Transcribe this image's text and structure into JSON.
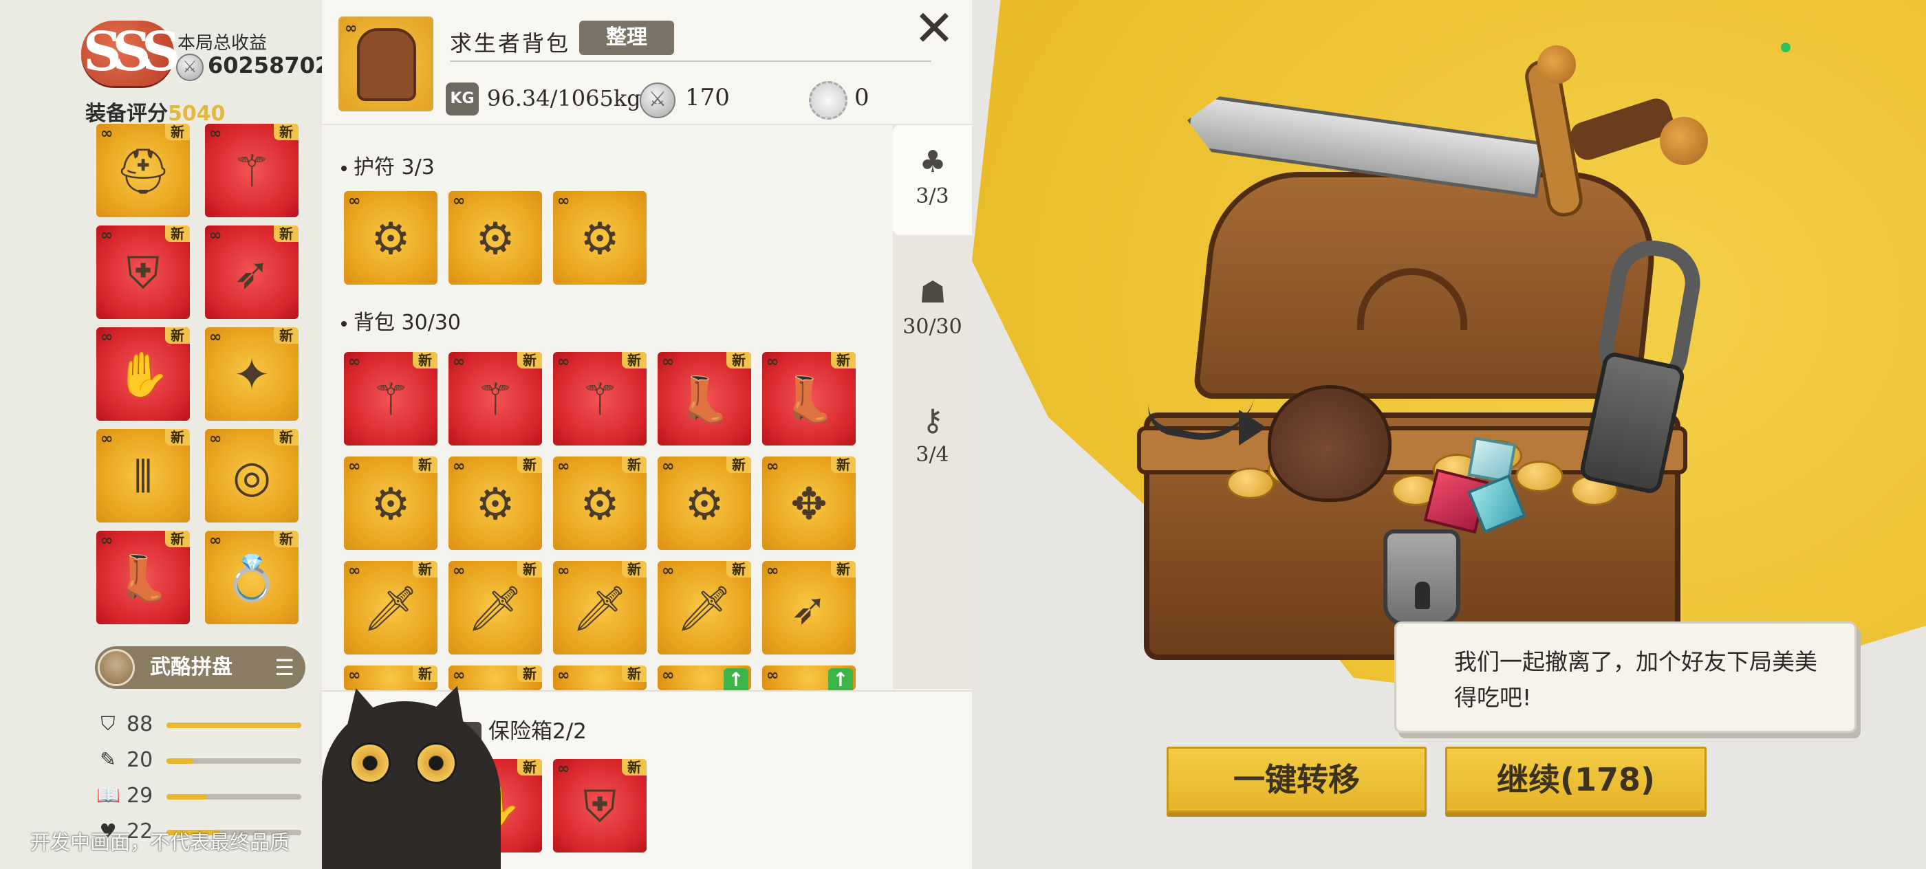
{
  "left_panel": {
    "rank": "SSS",
    "earn_label": "本局总收益",
    "earn_value": "60258702",
    "score_label": "装备评分",
    "score_value": "5040",
    "new_tag": "新",
    "equip_slots": [
      {
        "art": "helmet-icon",
        "rarity": "gold"
      },
      {
        "art": "spear-icon",
        "rarity": "red"
      },
      {
        "art": "armor-icon",
        "rarity": "red"
      },
      {
        "art": "bow-icon",
        "rarity": "red"
      },
      {
        "art": "purple-gauntlet-icon",
        "rarity": "red"
      },
      {
        "art": "star-amulet-icon",
        "rarity": "gold"
      },
      {
        "art": "pants-icon",
        "rarity": "gold"
      },
      {
        "art": "bracelet-icon",
        "rarity": "gold"
      },
      {
        "art": "winged-boots-icon",
        "rarity": "red"
      },
      {
        "art": "ruby-ring-icon",
        "rarity": "gold"
      }
    ],
    "puzzle_button": "武酪拼盘",
    "stats": [
      {
        "icon": "shield-stat-icon",
        "value": "88",
        "fill": 1.0
      },
      {
        "icon": "quill-stat-icon",
        "value": "20",
        "fill": 0.2
      },
      {
        "icon": "book-stat-icon",
        "value": "29",
        "fill": 0.3
      },
      {
        "icon": "heart-stat-icon",
        "value": "22",
        "fill": 0.4
      }
    ],
    "watermark": "开发中画面，不代表最终品质"
  },
  "bag": {
    "title": "求生者背包",
    "sort_label": "整理",
    "close_label": "✕",
    "kg_badge": "KG",
    "weight": "96.34/1065kg",
    "coins": "170",
    "gears": "0",
    "amulet_section": "护符  3/3",
    "backpack_section": "背包  30/30",
    "tabs": [
      {
        "icon": "clover-icon",
        "count": "3/3"
      },
      {
        "icon": "backpack-icon",
        "count": "30/30"
      },
      {
        "icon": "key-icon",
        "count": "3/4"
      }
    ],
    "amulet_slots": 3,
    "backpack_rows": [
      [
        "spear-icon",
        "spear-icon",
        "spear-icon",
        "winged-boots-icon",
        "winged-boots-icon"
      ],
      [
        "amulet-icon",
        "amulet-icon",
        "amulet-icon",
        "amulet-icon",
        "creature-icon"
      ],
      [
        "dagger-icon",
        "dagger-icon",
        "dagger-icon",
        "dagger-icon",
        "bow-icon"
      ]
    ],
    "safe_title": "保险箱2/2",
    "safe_slots": [
      "purple-gauntlet-icon",
      "armor-icon"
    ]
  },
  "scene": {
    "speech": "我们一起撤离了，加个好友下局美美得吃吧!",
    "transfer_button": "一键转移",
    "continue_button": "继续(178)"
  }
}
